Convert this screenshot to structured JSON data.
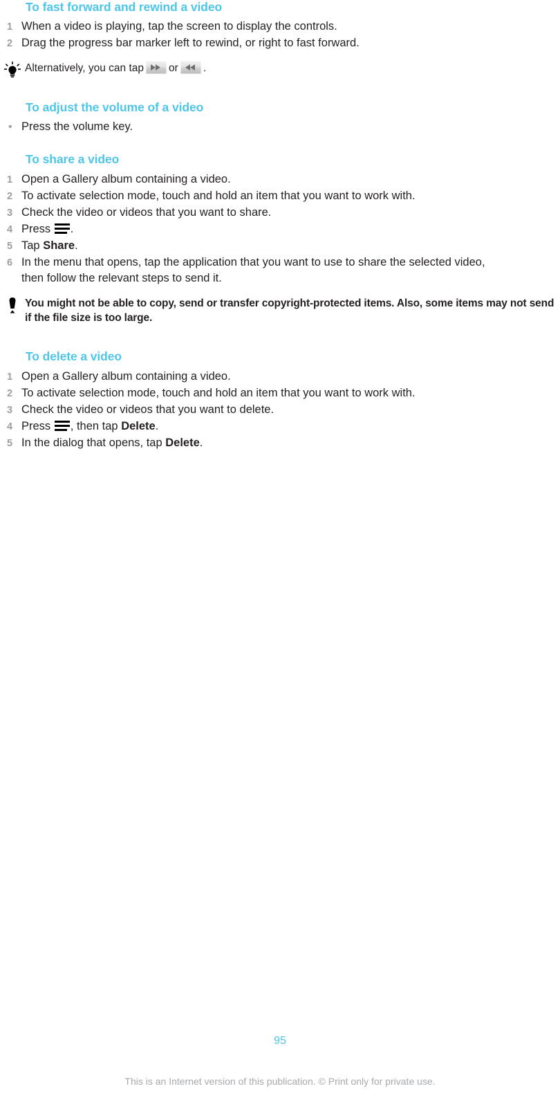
{
  "document": {
    "page_number": "95",
    "footer_note": "This is an Internet version of this publication. © Print only for private use.",
    "heading_color": "#4EC6E8",
    "step_number_color": "#9D9D9D",
    "body_text_color": "#231F20",
    "footer_note_color": "#A7A9AC"
  },
  "sections": [
    {
      "id": "fast-forward-rewind",
      "heading": "To fast forward and rewind a video",
      "steps": [
        {
          "marker": "1",
          "text": "When a video is playing, tap the screen to display the controls."
        },
        {
          "marker": "2",
          "text": "Drag the progress bar marker left to rewind, or right to fast forward."
        }
      ],
      "note": {
        "type": "tip",
        "icon": "lightbulb-icon",
        "text_before": "Alternatively, you can tap",
        "icon_1": "fast-forward-icon",
        "text_middle": "or",
        "icon_2": "rewind-icon",
        "text_after": "."
      }
    },
    {
      "id": "adjust-volume",
      "heading": "To adjust the volume of a video",
      "steps": [
        {
          "marker": "•",
          "text": "Press the volume key."
        }
      ]
    },
    {
      "id": "share-video",
      "heading": "To share a video",
      "steps": [
        {
          "marker": "1",
          "text": "Open a Gallery album containing a video."
        },
        {
          "marker": "2",
          "text": "To activate selection mode, touch and hold an item that you want to work with."
        },
        {
          "marker": "3",
          "text": "Check the video or videos that you want to share."
        },
        {
          "marker": "4",
          "text_before": "Press",
          "icon": "menu-icon",
          "text_after": "."
        },
        {
          "marker": "5",
          "text_before": "Tap",
          "bold": "Share",
          "text_after": "."
        },
        {
          "marker": "6",
          "text": "In the menu that opens, tap the application that you want to use to share the selected video, then follow the relevant steps to send it."
        }
      ],
      "note": {
        "type": "warning",
        "icon": "exclamation-icon",
        "text": "You might not be able to copy, send or transfer copyright-protected items. Also, some items may not send if the file size is too large."
      }
    },
    {
      "id": "delete-video",
      "heading": "To delete a video",
      "steps": [
        {
          "marker": "1",
          "text": "Open a Gallery album containing a video."
        },
        {
          "marker": "2",
          "text": "To activate selection mode, touch and hold an item that you want to work with."
        },
        {
          "marker": "3",
          "text": "Check the video or videos that you want to delete."
        },
        {
          "marker": "4",
          "text_before": "Press",
          "icon": "menu-icon",
          "text_middle": ", then tap",
          "bold": "Delete",
          "text_after": "."
        },
        {
          "marker": "5",
          "text_before": "In the dialog that opens, tap",
          "bold": "Delete",
          "text_after": "."
        }
      ]
    }
  ]
}
